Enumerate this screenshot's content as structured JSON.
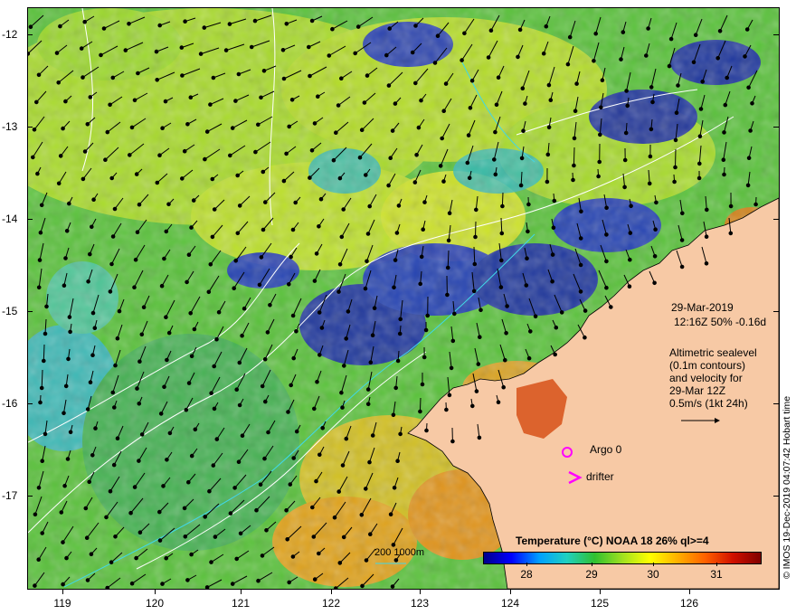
{
  "map": {
    "y_ticks": [
      "-12",
      "-13",
      "-14",
      "-15",
      "-16",
      "-17"
    ],
    "x_ticks": [
      "119",
      "120",
      "121",
      "122",
      "123",
      "124",
      "125",
      "126"
    ],
    "colors": {
      "land": "#f7c9a5",
      "sea_warm": "#4cb848",
      "sea_cool": "#3bb4d8",
      "sea_cold": "#10108a",
      "sea_hot": "#e07a10",
      "contour": "#ffffff",
      "shelf": "#40d8e8",
      "argo": "#ff00ff"
    },
    "argo_label": "Argo 0",
    "drifter_label": "drifter",
    "contour_legend": "200  1000m"
  },
  "info": {
    "date": "29-Mar-2019",
    "time_line": "12:16Z  50% -0.16d",
    "alt_line1": "Altimetric sealevel",
    "alt_line2": "(0.1m contours)",
    "alt_line3": "and velocity for",
    "alt_line4": "29-Mar 12Z",
    "alt_line5": "0.5m/s (1kt 24h)"
  },
  "colorbar": {
    "title": "Temperature (°C) NOAA 18 26% ql>=4",
    "labels": [
      "28",
      "29",
      "30",
      "31"
    ],
    "stops": [
      "#00008b",
      "#0000ff",
      "#00a0ff",
      "#20d0c0",
      "#30c030",
      "#a0e020",
      "#ffff00",
      "#ffb000",
      "#ff6000",
      "#d01000",
      "#800000"
    ]
  },
  "credit": "© IMOS 19-Dec-2019 04:07:42 Hobart time"
}
